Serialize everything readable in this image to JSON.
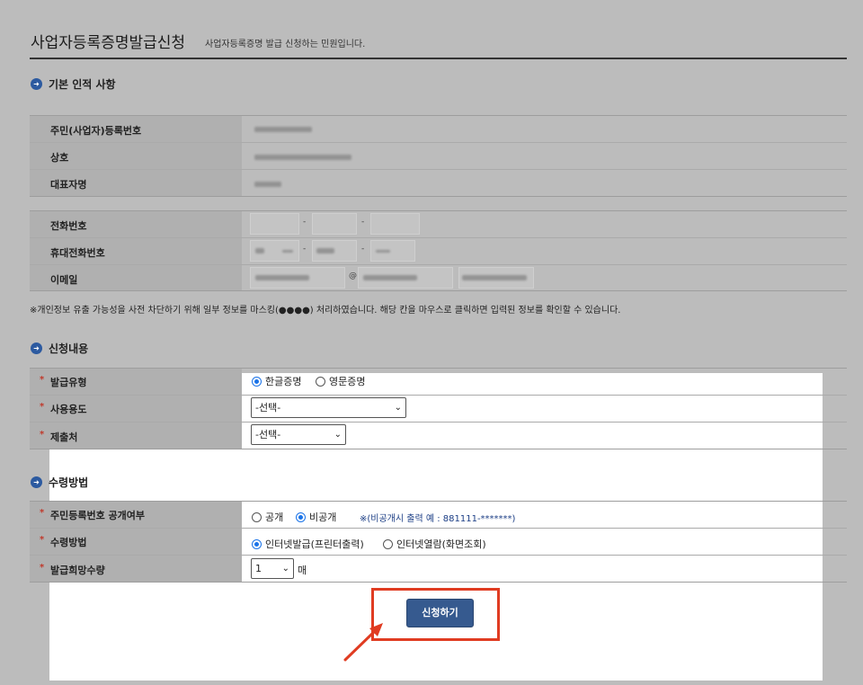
{
  "page": {
    "title": "사업자등록증명발급신청",
    "subtitle": "사업자등록증명 발급 신청하는 민원입니다."
  },
  "section1": {
    "title": "기본 인적 사항",
    "rows": [
      {
        "label": "주민(사업자)등록번호"
      },
      {
        "label": "상호"
      },
      {
        "label": "대표자명"
      }
    ],
    "contact_rows": [
      {
        "label": "전화번호"
      },
      {
        "label": "휴대전화번호"
      },
      {
        "label": "이메일"
      }
    ],
    "dash": "-",
    "at": "@",
    "notice": "※개인정보 유출 가능성을 사전 차단하기 위해 일부 정보를 마스킹(●●●●) 처리하였습니다. 해당 칸을 마우스로 클릭하면 입력된 정보를 확인할 수 있습니다."
  },
  "section2": {
    "title": "신청내용",
    "issue_type": {
      "label": "발급유형",
      "options": [
        "한글증명",
        "영문증명"
      ],
      "selected": "한글증명"
    },
    "usage": {
      "label": "사용용도",
      "value": "-선택-"
    },
    "submit_to": {
      "label": "제출처",
      "value": "-선택-"
    }
  },
  "section3": {
    "title": "수령방법",
    "id_disclosure": {
      "label": "주민등록번호 공개여부",
      "options": [
        "공개",
        "비공개"
      ],
      "selected": "비공개",
      "hint": "※(비공개시 출력 예 : 881111-*******)"
    },
    "receive_method": {
      "label": "수령방법",
      "options": [
        "인터넷발급(프린터출력)",
        "인터넷열람(화면조회)"
      ],
      "selected": "인터넷발급(프린터출력)"
    },
    "copies": {
      "label": "발급희망수량",
      "value": "1",
      "unit": "매"
    }
  },
  "required_mark": "*",
  "submit_label": "신청하기",
  "accent_colors": {
    "button": "#365a8f",
    "highlight_box": "#e03c22",
    "radio_selected": "#1a73e8"
  }
}
